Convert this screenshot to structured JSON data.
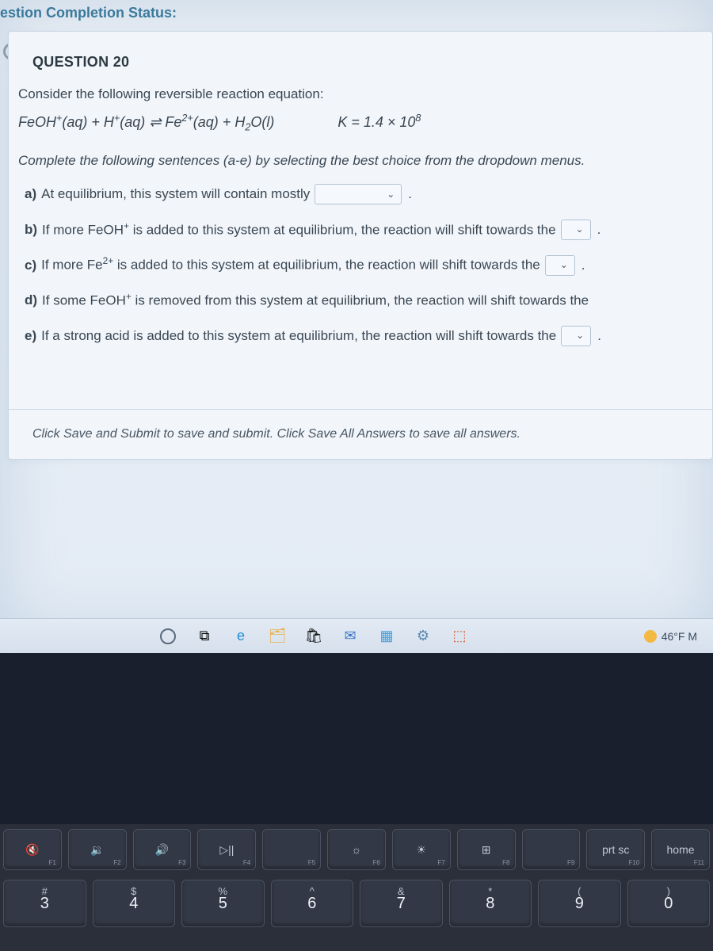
{
  "status_bar": "estion Completion Status:",
  "blur": "3",
  "question": {
    "header": "QUESTION 20",
    "prompt": "Consider the following reversible reaction equation:",
    "equation_lhs_1": "FeOH",
    "equation_lhs_1_sup": "+",
    "equation_lhs_1_phase": "(aq)",
    "plus": " + ",
    "equation_lhs_2": "H",
    "equation_lhs_2_sup": "+",
    "equation_lhs_2_phase": "(aq)",
    "arrows": " ⇌ ",
    "equation_rhs_1": "Fe",
    "equation_rhs_1_sup": "2+",
    "equation_rhs_1_phase": "(aq)",
    "equation_rhs_2": "H",
    "equation_rhs_2_sub": "2",
    "equation_rhs_2_tail": "O(l)",
    "k_expr_a": "K = 1.4 × 10",
    "k_expr_sup": "8",
    "instruction": "Complete the following sentences (a-e) by selecting the best choice from the dropdown menus.",
    "parts": {
      "a": {
        "label": "a)",
        "text": "At equilibrium, this system will contain mostly"
      },
      "b": {
        "label": "b)",
        "text_a": "If more FeOH",
        "sup": "+",
        "text_b": " is added to this system at equilibrium, the reaction will shift towards the"
      },
      "c": {
        "label": "c)",
        "text_a": "If more Fe",
        "sup": "2+",
        "text_b": " is added to this system at equilibrium, the reaction will shift towards the"
      },
      "d": {
        "label": "d)",
        "text_a": "If some FeOH",
        "sup": "+",
        "text_b": " is removed from this system at equilibrium, the reaction will shift towards the"
      },
      "e": {
        "label": "e)",
        "text": "If a strong acid is added to this system at equilibrium, the reaction will shift towards the"
      }
    },
    "footer": "Click Save and Submit to save and submit. Click Save All Answers to save all answers."
  },
  "taskbar": {
    "weather": "46°F M"
  },
  "keyboard": {
    "fn": [
      {
        "icon": "🔇",
        "sub": "F1"
      },
      {
        "icon": "🔉",
        "sub": "F2"
      },
      {
        "icon": "🔊",
        "sub": "F3"
      },
      {
        "icon": "▷||",
        "sub": "F4"
      },
      {
        "icon": "",
        "sub": "F5"
      },
      {
        "icon": "☼",
        "sub": "F6"
      },
      {
        "icon": "☀",
        "sub": "F7"
      },
      {
        "icon": "⊞",
        "sub": "F8"
      },
      {
        "icon": "",
        "sub": "F9"
      },
      {
        "icon": "prt sc",
        "sub": "F10"
      },
      {
        "icon": "home",
        "sub": "F11"
      }
    ],
    "num": [
      {
        "sym": "#",
        "num": "3"
      },
      {
        "sym": "$",
        "num": "4"
      },
      {
        "sym": "%",
        "num": "5"
      },
      {
        "sym": "^",
        "num": "6"
      },
      {
        "sym": "&",
        "num": "7"
      },
      {
        "sym": "*",
        "num": "8"
      },
      {
        "sym": "(",
        "num": "9"
      },
      {
        "sym": ")",
        "num": "0"
      }
    ]
  }
}
